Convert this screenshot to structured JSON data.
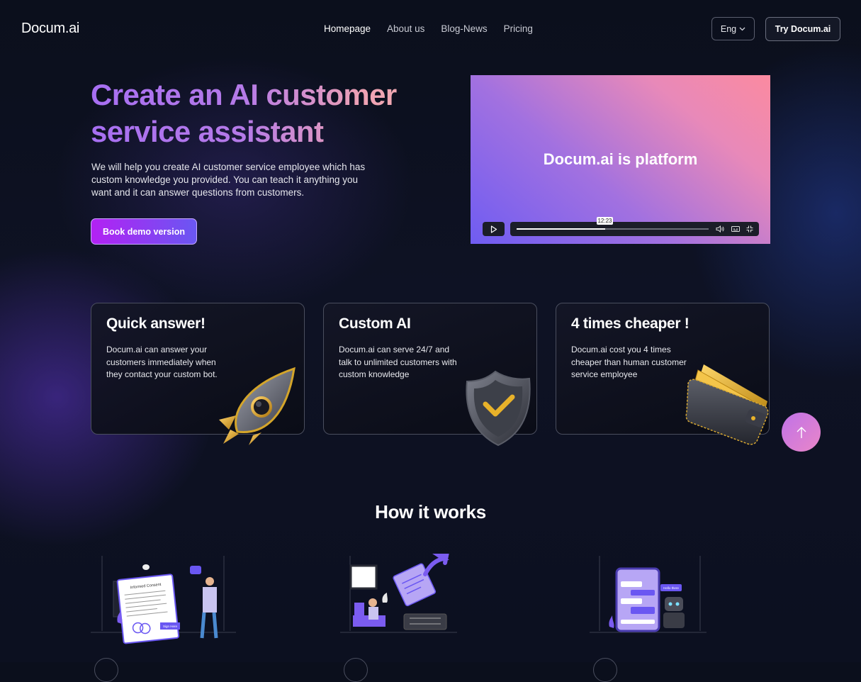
{
  "header": {
    "logo": "Docum.ai",
    "nav": [
      "Homepage",
      "About us",
      "Blog-News",
      "Pricing"
    ],
    "language": "Eng",
    "cta_label": "Try Docum.ai"
  },
  "hero": {
    "title_line1": "Create an AI customer",
    "title_line2": "service assistant",
    "description": "We will help you create AI customer service employee which has custom knowledge you provided. You can teach it anything you want and it can answer questions from customers.",
    "button_label": "Book demo version"
  },
  "video": {
    "title": "Docum.ai is platform",
    "timestamp": "12:23",
    "progress": 0.46
  },
  "features": [
    {
      "title": "Quick answer!",
      "text": "Docum.ai can answer your customers immediately  when they contact your custom bot.",
      "art": "rocket-icon"
    },
    {
      "title": "Custom AI",
      "text": "Docum.ai can serve 24/7 and talk to unlimited customers with custom knowledge",
      "art": "shield-check-icon"
    },
    {
      "title": "4 times cheaper !",
      "text": "Docum.ai cost you 4 times cheaper than human customer service employee",
      "art": "wallet-icon"
    }
  ],
  "how": {
    "title": "How it works",
    "illustrations": [
      {
        "label": "Informed Consent",
        "stamp": "Sign Here"
      },
      {
        "label": ""
      },
      {
        "label": "Hello there"
      }
    ]
  },
  "colors": {
    "accent_purple": "#6a57f2",
    "accent_magenta": "#b321f3",
    "background": "#0b0f1c"
  }
}
